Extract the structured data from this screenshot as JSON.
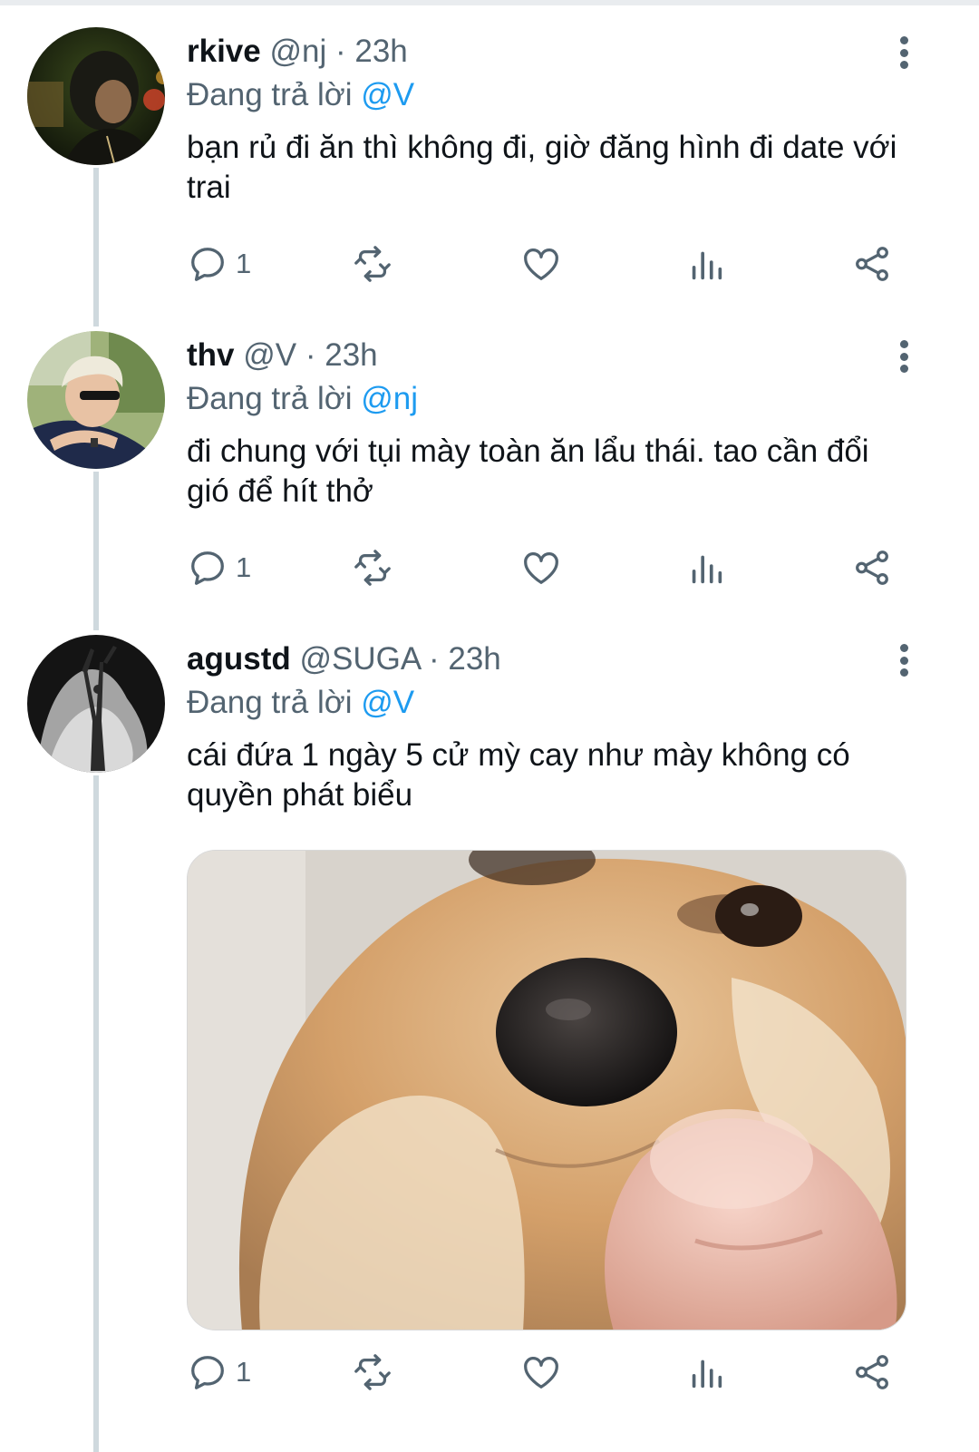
{
  "tweets": [
    {
      "name": "rkive",
      "handle": "@nj",
      "time": "· 23h",
      "reply_prefix": "Đang trả lời",
      "reply_to": "@V",
      "text": "bạn rủ đi ăn thì không đi, giờ đăng hình đi date với trai",
      "reply_count": "1",
      "avatar": "person-dark-portrait"
    },
    {
      "name": "thv",
      "handle": "@V",
      "time": "· 23h",
      "reply_prefix": "Đang trả lời",
      "reply_to": "@nj",
      "text": "đi chung với tụi mày toàn ăn lẩu thái. tao cần đổi gió để hít thở",
      "reply_count": "1",
      "avatar": "blond-person-sunglasses"
    },
    {
      "name": "agustd",
      "handle": "@SUGA",
      "time": "· 23h",
      "reply_prefix": "Đang trả lời",
      "reply_to": "@V",
      "text": "cái đứa 1 ngày 5 cử mỳ cay như mày không có quyền phát biểu",
      "reply_count": "1",
      "avatar": "black-white-statue",
      "media": "shiba-dog-pointing-finger"
    }
  ],
  "icons": {
    "reply": "reply-icon",
    "retweet": "retweet-icon",
    "like": "heart-icon",
    "views": "analytics-icon",
    "share": "share-icon",
    "more": "more-vertical-icon"
  },
  "colors": {
    "text": "#0f1419",
    "secondary": "#536471",
    "mention": "#1d9bf0",
    "thread_line": "#cfd9de"
  }
}
